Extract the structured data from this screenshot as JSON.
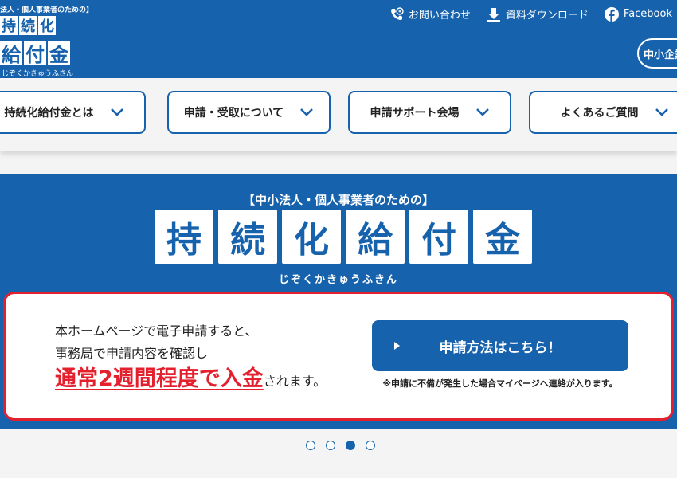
{
  "header": {
    "logo": {
      "subtitle": "法人・個人事業者のための】",
      "row1": [
        "持",
        "続",
        "化"
      ],
      "row2": [
        "給",
        "付",
        "金"
      ],
      "kana": "じぞくかきゅうふきん"
    },
    "links": [
      {
        "label": "お問い合わせ",
        "icon": "phone-icon"
      },
      {
        "label": "資料ダウンロード",
        "icon": "download-icon"
      },
      {
        "label": "Facebook",
        "icon": "facebook-icon"
      }
    ],
    "sme_logo": "中小企業庁"
  },
  "nav": {
    "items": [
      {
        "label": "持続化給付金とは"
      },
      {
        "label": "申請・受取について"
      },
      {
        "label": "申請サポート会場"
      },
      {
        "label": "よくあるご質問"
      }
    ]
  },
  "hero": {
    "subtitle": "【中小法人・個人事業者のための】",
    "title_chars": [
      "持",
      "続",
      "化",
      "給",
      "付",
      "金"
    ],
    "kana": "じぞくかきゅうふきん",
    "info": {
      "line1": "本ホームページで電子申請すると、",
      "line2": "事務局で申請内容を確認し",
      "highlight": "通常2週間程度で入金",
      "highlight_tail": "されます。",
      "button_label": "申請方法はこちら！",
      "note": "※申請に不備が発生した場合マイページへ連絡が入ります。"
    }
  },
  "carousel": {
    "total": 4,
    "active": 3
  },
  "colors": {
    "primary": "#1762ad",
    "accent_red": "#e5202e",
    "background": "#f4f4f4"
  }
}
